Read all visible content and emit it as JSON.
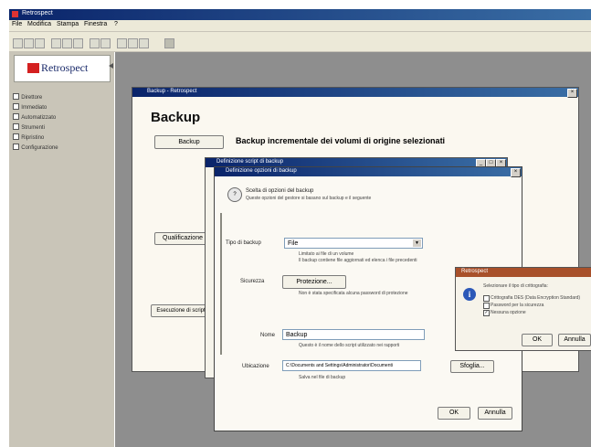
{
  "app": {
    "title": "Retrospect",
    "menu": [
      "File",
      "Modifica",
      "Stampa",
      "Finestra",
      "?"
    ]
  },
  "sidebar": {
    "logo_text": "Retrospect",
    "items": [
      "Direttore",
      "Immediato",
      "Automatizzato",
      "Strumenti",
      "Ripristino",
      "Configurazione"
    ]
  },
  "backup_window": {
    "title": "Backup - Retrospect",
    "heading": "Backup",
    "button_backup": "Backup",
    "description": "Backup incrementale dei volumi di origine selezionati",
    "button_qualification": "Qualificazione",
    "button_script": "Esecuzione di script"
  },
  "script_window": {
    "title": "Definizione script di backup"
  },
  "options_dialog": {
    "title": "Definizione opzioni di backup",
    "intro_line1": "Scelta di opzioni del backup",
    "intro_line2": "Queste opzioni del gestore si basano sul backup e il seguente",
    "type_label": "Tipo di backup",
    "type_value": "File",
    "type_note1": "Limitato ai file di un volume",
    "type_note2": "Il backup contiene file aggiornati ed elenca i file precedenti",
    "security_label": "Sicurezza",
    "security_button": "Protezione...",
    "security_note": "Non è stata specificata alcuna password di protezione",
    "name_label": "Nome",
    "name_value": "Backup",
    "name_note": "Questo è il nome dello script utilizzato nei rapporti",
    "location_label": "Ubicazione",
    "location_value": "C:\\Documents and Settings\\Administrator\\Documenti",
    "browse_button": "Sfoglia...",
    "location_note": "Salva nel file di backup",
    "ok_button": "OK",
    "cancel_button": "Annulla"
  },
  "encryption_dialog": {
    "title": "Retrospect",
    "prompt": "Selezionare il tipo di crittografia:",
    "options": [
      {
        "label": "Crittografia DES (Data Encryption Standard)",
        "checked": false
      },
      {
        "label": "Password per la sicurezza",
        "checked": false
      },
      {
        "label": "Nessuna opzione",
        "checked": true
      }
    ],
    "ok_button": "OK",
    "cancel_button": "Annulla"
  }
}
